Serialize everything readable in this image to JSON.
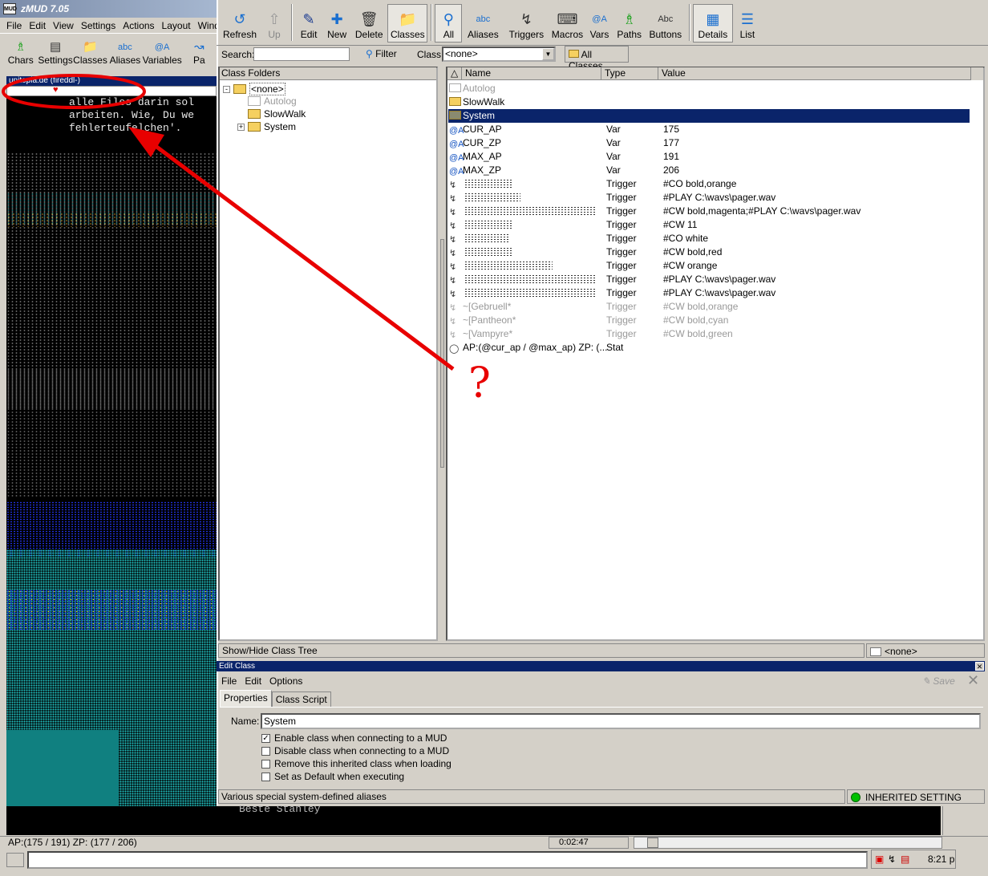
{
  "main_window": {
    "title": "zMUD 7.05",
    "app_icon": "MUD",
    "menu": [
      "File",
      "Edit",
      "View",
      "Settings",
      "Actions",
      "Layout",
      "Wind"
    ],
    "toolbar": [
      {
        "label": "Chars",
        "icon": "walking-man-icon"
      },
      {
        "label": "Settings",
        "icon": "settings-sheet-icon"
      },
      {
        "label": "Classes",
        "icon": "folder-icon"
      },
      {
        "label": "Aliases",
        "icon": "abc-icon"
      },
      {
        "label": "Variables",
        "icon": "at-a-icon"
      },
      {
        "label": "Pa",
        "icon": "path-icon"
      }
    ],
    "session_title": "unitopia.de (fireddl-)",
    "mud_lines": [
      "alle Files darin sol",
      "arbeiten. Wie, Du we",
      "fehlerteufelchen'."
    ],
    "mud_bottom_text": "Beste Stanley",
    "status": {
      "text": "AP:(175 / 191)  ZP: (177 / 206)",
      "clock": "0:02:47",
      "tray_clock": "8:21 p"
    }
  },
  "editor": {
    "toolbar": [
      {
        "label": "Refresh",
        "icon": "refresh-arrow-icon",
        "state": "normal"
      },
      {
        "label": "Up",
        "icon": "up-arrow-icon",
        "state": "disabled"
      },
      {
        "sep": true
      },
      {
        "label": "Edit",
        "icon": "pencil-icon",
        "state": "normal"
      },
      {
        "label": "New",
        "icon": "plus-icon",
        "state": "normal"
      },
      {
        "label": "Delete",
        "icon": "trash-icon",
        "state": "normal"
      },
      {
        "label": "Classes",
        "icon": "folder-icon",
        "state": "pressed"
      },
      {
        "sep": true
      },
      {
        "label": "All",
        "icon": "magnifier-icon",
        "state": "pressed"
      },
      {
        "label": "Aliases",
        "icon": "abc-icon",
        "state": "normal"
      },
      {
        "label": "Triggers",
        "icon": "gun-icon",
        "state": "normal"
      },
      {
        "label": "Macros",
        "icon": "key-icon",
        "state": "normal"
      },
      {
        "label": "Vars",
        "icon": "at-a-icon",
        "state": "normal"
      },
      {
        "label": "Paths",
        "icon": "walking-man-icon",
        "state": "normal"
      },
      {
        "label": "Buttons",
        "icon": "abc-button-icon",
        "state": "normal"
      },
      {
        "sep": true
      },
      {
        "label": "Details",
        "icon": "details-icon",
        "state": "pressed"
      },
      {
        "label": "List",
        "icon": "list-icon",
        "state": "normal"
      }
    ],
    "search_label": "Search:",
    "search_value": "",
    "filter_label": "Filter",
    "class_label": "Class:",
    "class_value": "<none>",
    "all_classes_label": "All Classes",
    "tree_header": "Class Folders",
    "tree": [
      {
        "label": "<none>",
        "level": 0,
        "expander": "-",
        "folder": "open"
      },
      {
        "label": "Autolog",
        "level": 1,
        "expander": "",
        "folder": "gray"
      },
      {
        "label": "SlowWalk",
        "level": 1,
        "expander": "",
        "folder": "normal"
      },
      {
        "label": "System",
        "level": 1,
        "expander": "+",
        "folder": "normal"
      }
    ],
    "list_columns": [
      "Name",
      "Type",
      "Value"
    ],
    "list_sort_icon": "sort-up-icon",
    "rows": [
      {
        "name": "Autolog",
        "type": "",
        "value": "",
        "kind": "folder",
        "dim": true
      },
      {
        "name": "SlowWalk",
        "type": "",
        "value": "",
        "kind": "folder"
      },
      {
        "name": "System",
        "type": "",
        "value": "",
        "kind": "folder",
        "selected": true
      },
      {
        "name": "CUR_AP",
        "type": "Var",
        "value": "175",
        "kind": "var"
      },
      {
        "name": "CUR_ZP",
        "type": "Var",
        "value": "177",
        "kind": "var"
      },
      {
        "name": "MAX_AP",
        "type": "Var",
        "value": "191",
        "kind": "var"
      },
      {
        "name": "MAX_ZP",
        "type": "Var",
        "value": "206",
        "kind": "var"
      },
      {
        "name": "",
        "type": "Trigger",
        "value": "#CO bold,orange",
        "kind": "trigger",
        "blur": 60
      },
      {
        "name": "",
        "type": "Trigger",
        "value": "#PLAY C:\\wavs\\pager.wav",
        "kind": "trigger",
        "blur": 70
      },
      {
        "name": "",
        "type": "Trigger",
        "value": "#CW bold,magenta;#PLAY C:\\wavs\\pager.wav",
        "kind": "trigger",
        "blur": 165
      },
      {
        "name": "",
        "type": "Trigger",
        "value": "#CW 11",
        "kind": "trigger",
        "blur": 60
      },
      {
        "name": "",
        "type": "Trigger",
        "value": "#CO white",
        "kind": "trigger",
        "blur": 55
      },
      {
        "name": "",
        "type": "Trigger",
        "value": "#CW bold,red",
        "kind": "trigger",
        "blur": 60
      },
      {
        "name": "",
        "type": "Trigger",
        "value": "#CW orange",
        "kind": "trigger",
        "blur": 110
      },
      {
        "name": "",
        "type": "Trigger",
        "value": "#PLAY C:\\wavs\\pager.wav",
        "kind": "trigger",
        "blur": 165
      },
      {
        "name": "",
        "type": "Trigger",
        "value": "#PLAY C:\\wavs\\pager.wav",
        "kind": "trigger",
        "blur": 165
      },
      {
        "name": "~[Gebruell*",
        "type": "Trigger",
        "value": "#CW bold,orange",
        "kind": "trigger",
        "dim": true
      },
      {
        "name": "~[Pantheon*",
        "type": "Trigger",
        "value": "#CW bold,cyan",
        "kind": "trigger",
        "dim": true
      },
      {
        "name": "~[Vampyre*",
        "type": "Trigger",
        "value": "#CW bold,green",
        "kind": "trigger",
        "dim": true
      },
      {
        "name": "AP:(@cur_ap / @max_ap)  ZP: (...",
        "type": "Stat",
        "value": "",
        "kind": "stat"
      }
    ],
    "show_hide_label": "Show/Hide Class Tree",
    "current_class": "<none>"
  },
  "edit_class": {
    "title": "Edit Class",
    "menu": [
      "File",
      "Edit",
      "Options"
    ],
    "save_label": "Save",
    "tabs": [
      {
        "label": "Properties",
        "active": true
      },
      {
        "label": "Class Script",
        "active": false
      }
    ],
    "name_label": "Name:",
    "name_value": "System",
    "options": [
      {
        "label": "Enable class when connecting to a MUD",
        "checked": true
      },
      {
        "label": "Disable class when connecting to a MUD",
        "checked": false
      },
      {
        "label": "Remove this inherited class when loading",
        "checked": false
      },
      {
        "label": "Set as Default when executing",
        "checked": false
      }
    ],
    "status_text": "Various special system-defined aliases",
    "inherited_label": "INHERITED SETTING"
  },
  "annotation": {
    "question_mark": "?",
    "color": "#e80000"
  }
}
